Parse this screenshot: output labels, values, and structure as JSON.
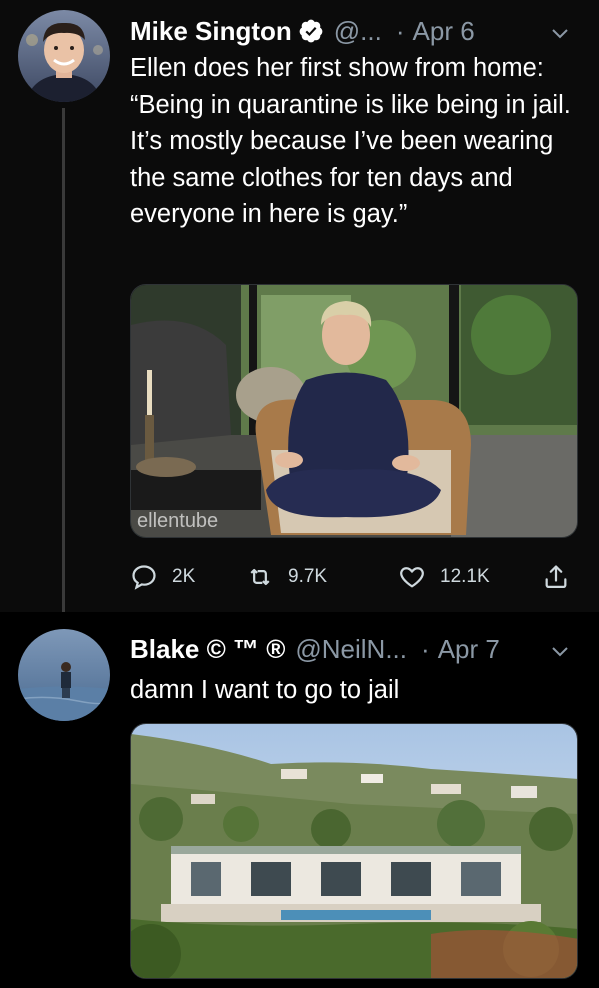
{
  "tweets": [
    {
      "display_name": "Mike Sington",
      "handle": "@...",
      "separator": "·",
      "date": "Apr 6",
      "text": "Ellen does her first show from home: “Being in quarantine is like being in jail. It’s mostly because I’ve been wearing the same clothes for ten days and everyone in here is gay.”",
      "verified": true,
      "media_watermark": "ellentube",
      "actions": {
        "reply_count": "2K",
        "retweet_count": "9.7K",
        "like_count": "12.1K"
      }
    },
    {
      "display_name": "Blake © ™ ®",
      "handle": "@NeilN...",
      "separator": "·",
      "date": "Apr 7",
      "text": "damn I want to go to jail"
    }
  ],
  "icons": {
    "verified": "verified-badge-icon",
    "caret": "chevron-down-icon",
    "reply": "reply-icon",
    "retweet": "retweet-icon",
    "like": "heart-icon",
    "share": "share-icon"
  },
  "colors": {
    "background": "#000000",
    "secondary_text": "#8b98a5",
    "text": "#ffffff"
  }
}
